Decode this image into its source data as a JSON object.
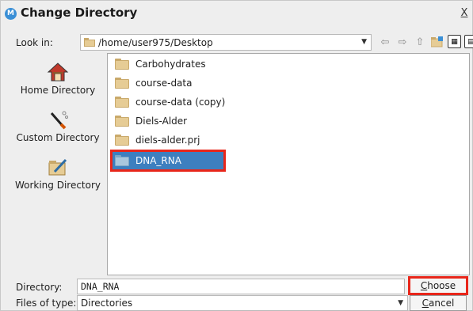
{
  "window": {
    "title": "Change Directory",
    "app_icon": "M",
    "close_label": "X"
  },
  "lookin": {
    "label": "Look in:",
    "path": "/home/user975/Desktop"
  },
  "toolbar": {
    "back_icon": "⇦",
    "forward_icon": "⇨",
    "up_icon": "⇧",
    "newfolder_icon": "new-folder-icon",
    "list_view_icon": "▦",
    "details_view_icon": "▤"
  },
  "shortcuts": [
    {
      "label": "Home Directory",
      "icon": "home-icon"
    },
    {
      "label": "Custom Directory",
      "icon": "brush-icon"
    },
    {
      "label": "Working Directory",
      "icon": "folder-pen-icon"
    }
  ],
  "files": [
    {
      "name": "Carbohydrates",
      "selected": false
    },
    {
      "name": "course-data",
      "selected": false
    },
    {
      "name": "course-data (copy)",
      "selected": false
    },
    {
      "name": "Diels-Alder",
      "selected": false
    },
    {
      "name": "diels-alder.prj",
      "selected": false
    },
    {
      "name": "DNA_RNA",
      "selected": true
    }
  ],
  "directory": {
    "label": "Directory:",
    "value": "DNA_RNA"
  },
  "files_of_type": {
    "label": "Files of type:",
    "value": "Directories"
  },
  "buttons": {
    "choose_first": "C",
    "choose_rest": "hoose",
    "cancel_first": "C",
    "cancel_rest": "ancel"
  },
  "colors": {
    "selection_bg": "#3d7fbf",
    "highlight_border": "#e8261a"
  }
}
